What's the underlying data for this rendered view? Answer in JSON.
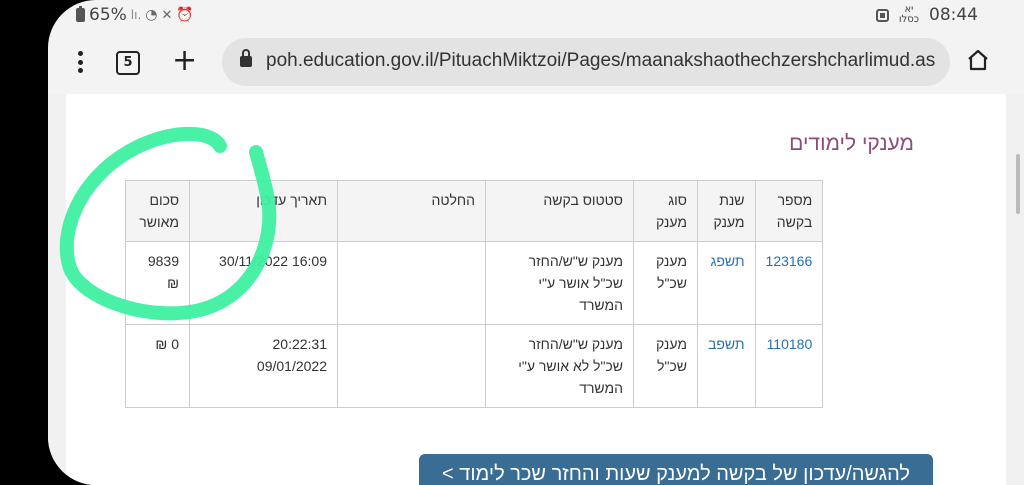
{
  "status_bar": {
    "battery": "65%",
    "signal_text": "lı.",
    "hebrew_date": "יא",
    "hebrew_month": "כסלו",
    "time": "08:44"
  },
  "browser": {
    "tab_count": "5",
    "url": "poh.education.gov.il/PituachMiktzoi/Pages/maanakshaothechzershcharlimud.as"
  },
  "page": {
    "title": "מענקי לימודים",
    "table": {
      "headers": [
        "מספר בקשה",
        "שנת מענק",
        "סוג מענק",
        "סטטוס בקשה",
        "החלטה",
        "תאריך עדכון",
        "סכום מאושר"
      ],
      "rows": [
        {
          "request_number": "123166",
          "year": "תשפג",
          "type": "מענק שכ\"ל",
          "status": "מענק ש\"ש/החזר שכ\"ל אושר ע\"י המשרד",
          "decision": "",
          "updated": "16:09 30/11/2022",
          "amount": "9839 ₪"
        },
        {
          "request_number": "110180",
          "year": "תשפב",
          "type": "מענק שכ\"ל",
          "status": "מענק ש\"ש/החזר שכ\"ל לא אושר ע\"י המשרד",
          "decision": "",
          "updated": "20:22:31 09/01/2022",
          "amount": "0 ₪"
        }
      ]
    },
    "cta_label": "להגשה/עדכון של בקשה למענק שעות והחזר שכר לימוד >"
  },
  "colors": {
    "title": "#8d4d7a",
    "link": "#2a6fb0",
    "button": "#3a6d93",
    "annotation": "#3ef0a0"
  }
}
